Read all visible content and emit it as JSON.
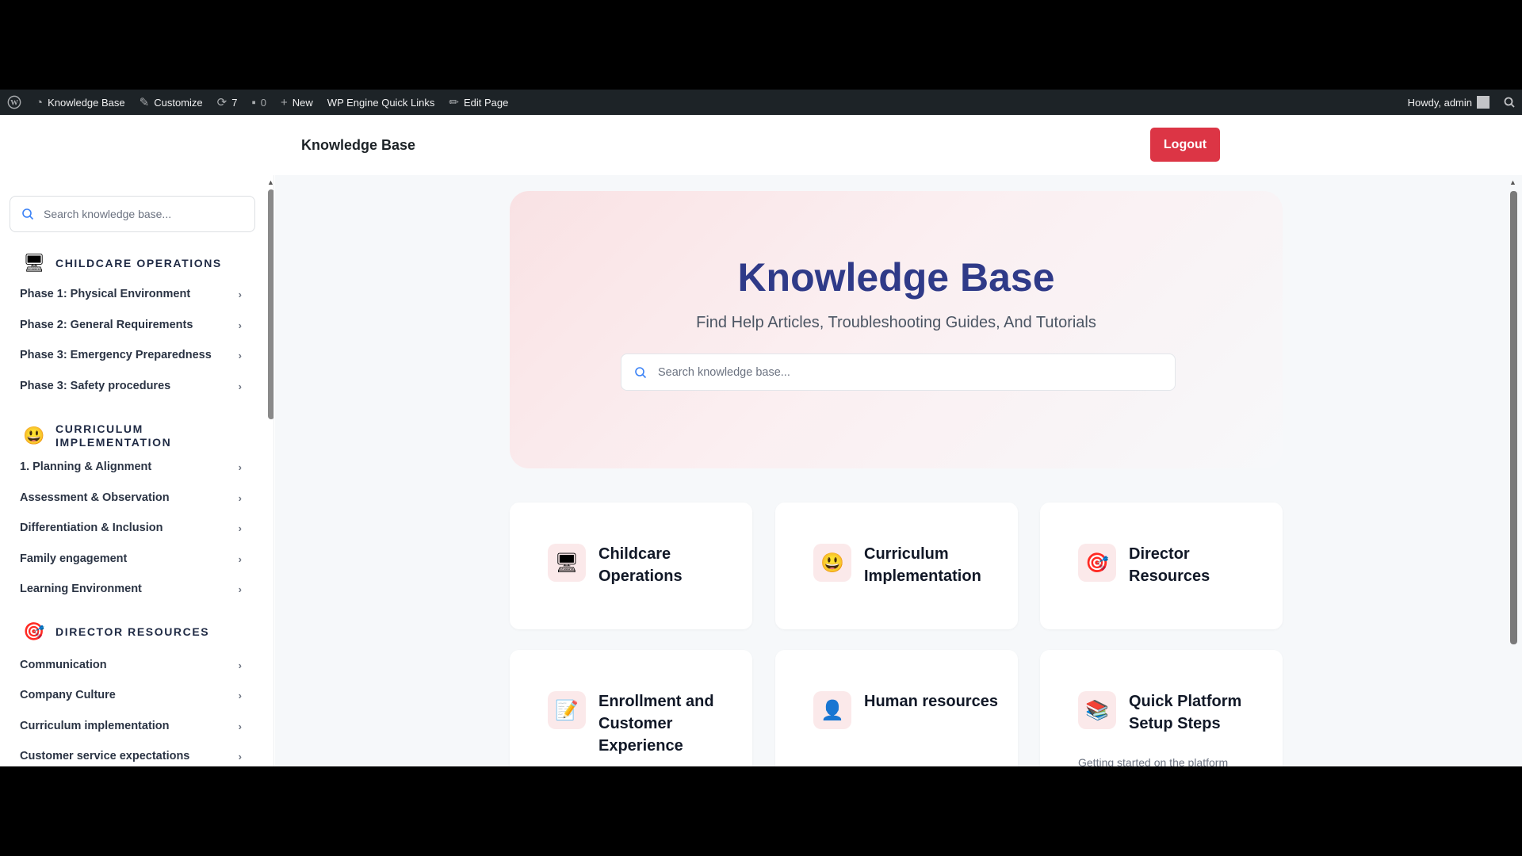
{
  "admin_bar": {
    "site_name": "Knowledge Base",
    "customize": "Customize",
    "updates_count": "7",
    "comments_count": "0",
    "new": "New",
    "quick_links": "WP Engine Quick Links",
    "edit_page": "Edit Page",
    "howdy": "Howdy, admin"
  },
  "header": {
    "title": "Knowledge Base",
    "logout_label": "Logout"
  },
  "sidebar": {
    "search_placeholder": "Search knowledge base...",
    "categories": [
      {
        "label": "CHILDCARE OPERATIONS",
        "icon": "computer-icon",
        "items": [
          "Phase 1: Physical Environment",
          "Phase 2: General Requirements",
          "Phase 3: Emergency Preparedness",
          "Phase 3: Safety procedures"
        ]
      },
      {
        "label": "CURRICULUM IMPLEMENTATION",
        "icon": "smiley-icon",
        "items": [
          "1. Planning & Alignment",
          "Assessment & Observation",
          "Differentiation & Inclusion",
          "Family engagement",
          "Learning Environment"
        ]
      },
      {
        "label": "DIRECTOR RESOURCES",
        "icon": "target-icon",
        "items": [
          "Communication",
          "Company Culture",
          "Curriculum implementation",
          "Customer service expectations"
        ]
      }
    ]
  },
  "hero": {
    "title": "Knowledge Base",
    "subtitle": "Find Help Articles, Troubleshooting Guides, And Tutorials",
    "search_placeholder": "Search knowledge base..."
  },
  "cards": [
    {
      "title": "Childcare Operations",
      "icon": "computer-icon",
      "description": ""
    },
    {
      "title": "Curriculum Implementation",
      "icon": "smiley-icon",
      "description": ""
    },
    {
      "title": "Director Resources",
      "icon": "target-icon",
      "description": ""
    },
    {
      "title": "Enrollment and Customer Experience",
      "icon": "memo-icon",
      "description": ""
    },
    {
      "title": "Human resources",
      "icon": "person-icon",
      "description": ""
    },
    {
      "title": "Quick Platform Setup Steps",
      "icon": "books-icon",
      "description": "Getting started on the platform"
    }
  ],
  "colors": {
    "admin_bar_bg": "#1d2327",
    "logout_bg": "#dc3545",
    "hero_title": "#2f3a88",
    "icon_tile_bg": "#fbe9ea"
  }
}
